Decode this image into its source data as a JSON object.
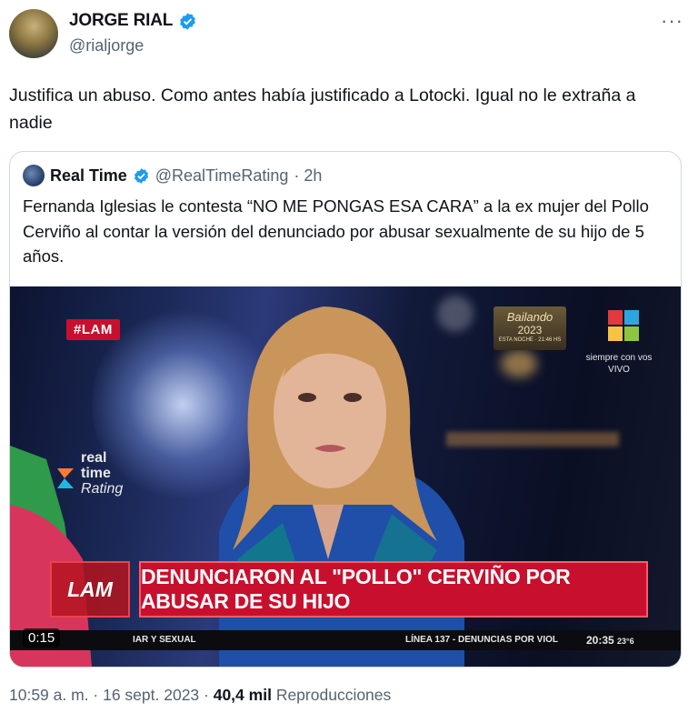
{
  "tweet": {
    "author_name": "JORGE RIAL",
    "handle": "@rialjorge",
    "more_glyph": "···",
    "text": "Justifica un abuso. Como antes había justificado a Lotocki. Igual no le extraña a nadie"
  },
  "quote": {
    "author_name": "Real Time",
    "handle": "@RealTimeRating",
    "time": "· 2h",
    "text": "Fernanda Iglesias le contesta “NO ME PONGAS ESA CARA” a la ex mujer del Pollo Cerviño al contar la versión del denunciado por abusar sexualmente de su hijo de 5 años."
  },
  "video": {
    "hashtag": "#LAM",
    "watermark": {
      "line1": "real",
      "line2": "time",
      "line3": "Rating"
    },
    "promo": {
      "line1": "Bailando",
      "line2": "2023",
      "line3": "ESTA NOCHE · 21:46 HS"
    },
    "channel_tag": {
      "line1": "siempre con vos",
      "line2": "VIVO"
    },
    "lower_third": {
      "logo": "LAM",
      "headline": "DENUNCIARON AL \"POLLO\" CERVIÑO POR ABUSAR DE SU HIJO"
    },
    "ticker": {
      "left": "IAR Y SEXUAL",
      "middle": "LÍNEA 137 - DENUNCIAS POR VIOL",
      "clock": "20:35",
      "temp": "23°6"
    },
    "duration": "0:15"
  },
  "footer": {
    "time": "10:59 a. m. · 16 sept. 2023 · ",
    "views": "40,4 mil",
    "views_label": "Reproducciones"
  },
  "colors": {
    "verified": "#1d9bf0",
    "accent_red": "#c8102e",
    "muted": "#536471"
  },
  "icons": [
    "verified-badge-icon",
    "more-icon",
    "telefe-logo-icon",
    "real-time-logo-icon"
  ]
}
